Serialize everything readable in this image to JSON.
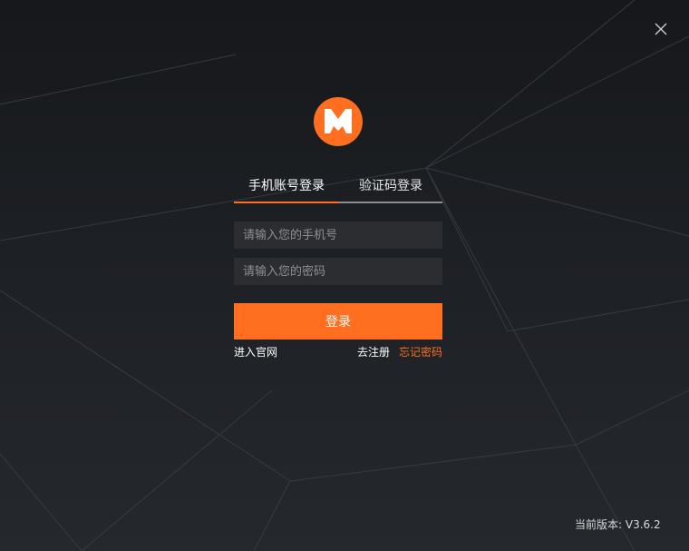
{
  "window": {
    "close_icon": "close-icon",
    "logo_icon": "m-logo-icon",
    "logo_letter": "M"
  },
  "tabs": [
    {
      "label": "手机账号登录",
      "active": true
    },
    {
      "label": "验证码登录",
      "active": false
    }
  ],
  "form": {
    "phone_placeholder": "请输入您的手机号",
    "phone_value": "",
    "password_placeholder": "请输入您的密码",
    "password_value": "",
    "login_label": "登录"
  },
  "links": {
    "website": "进入官网",
    "register": "去注册",
    "forgot_password": "忘记密码"
  },
  "footer": {
    "version": "当前版本: V3.6.2"
  },
  "colors": {
    "accent": "#ff6f1f",
    "background_top": "#16181b",
    "background_bottom": "#25282d",
    "input_background": "#2c2d30"
  }
}
